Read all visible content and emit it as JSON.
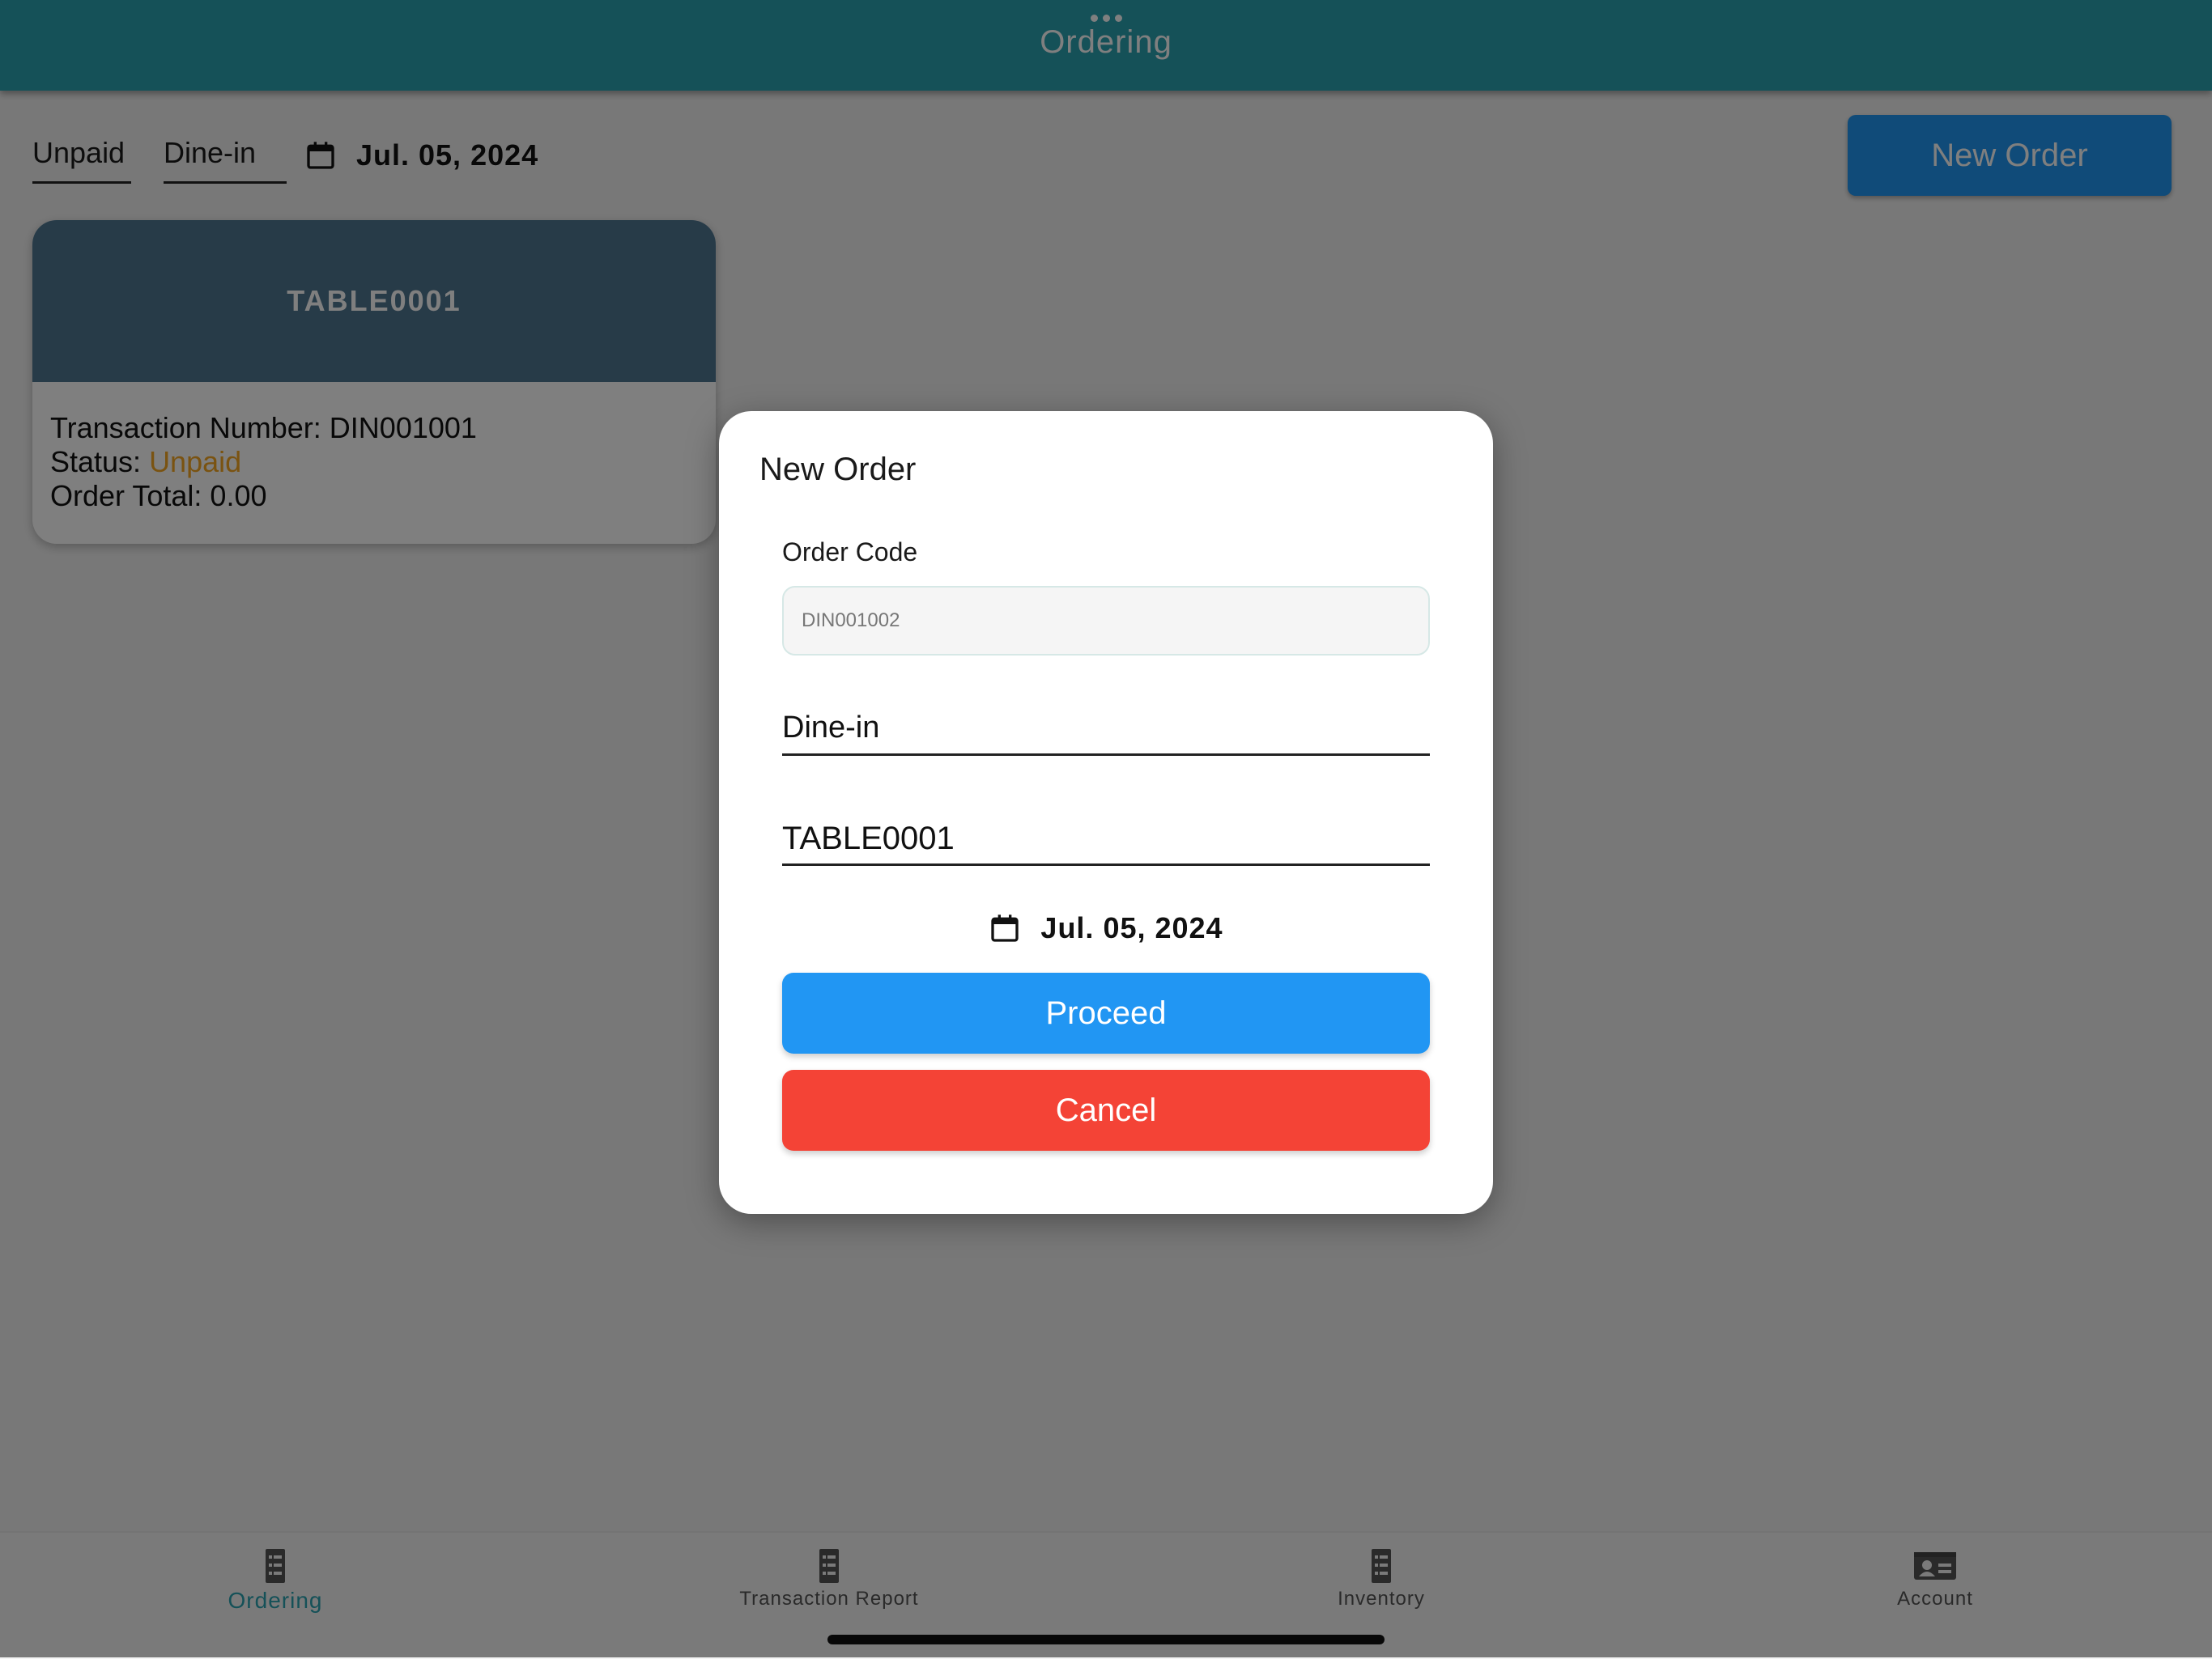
{
  "appbar": {
    "title": "Ordering"
  },
  "filters": {
    "status": "Unpaid",
    "order_type": "Dine-in",
    "date": "Jul. 05, 2024"
  },
  "toolbar": {
    "new_order_label": "New Order"
  },
  "orders": [
    {
      "table": "TABLE0001",
      "transaction_label": "Transaction Number: ",
      "transaction_number": "DIN001001",
      "status_label": "Status: ",
      "status": "Unpaid",
      "total_label": "Order Total: ",
      "total": "0.00"
    }
  ],
  "dialog": {
    "title": "New Order",
    "order_code_label": "Order Code",
    "order_code_value": "DIN001002",
    "order_type": "Dine-in",
    "table": "TABLE0001",
    "date": "Jul. 05, 2024",
    "proceed_label": "Proceed",
    "cancel_label": "Cancel"
  },
  "bottom_nav": [
    {
      "label": "Ordering",
      "icon": "list-icon",
      "active": true
    },
    {
      "label": "Transaction Report",
      "icon": "list-icon",
      "active": false
    },
    {
      "label": "Inventory",
      "icon": "list-icon",
      "active": false
    },
    {
      "label": "Account",
      "icon": "id-card-icon",
      "active": false
    }
  ],
  "colors": {
    "appbar": "#2aa2b1",
    "primary_button": "#2196f3",
    "cancel_button": "#f44336",
    "card_header": "#4f7691",
    "status_unpaid": "#f5a623"
  }
}
